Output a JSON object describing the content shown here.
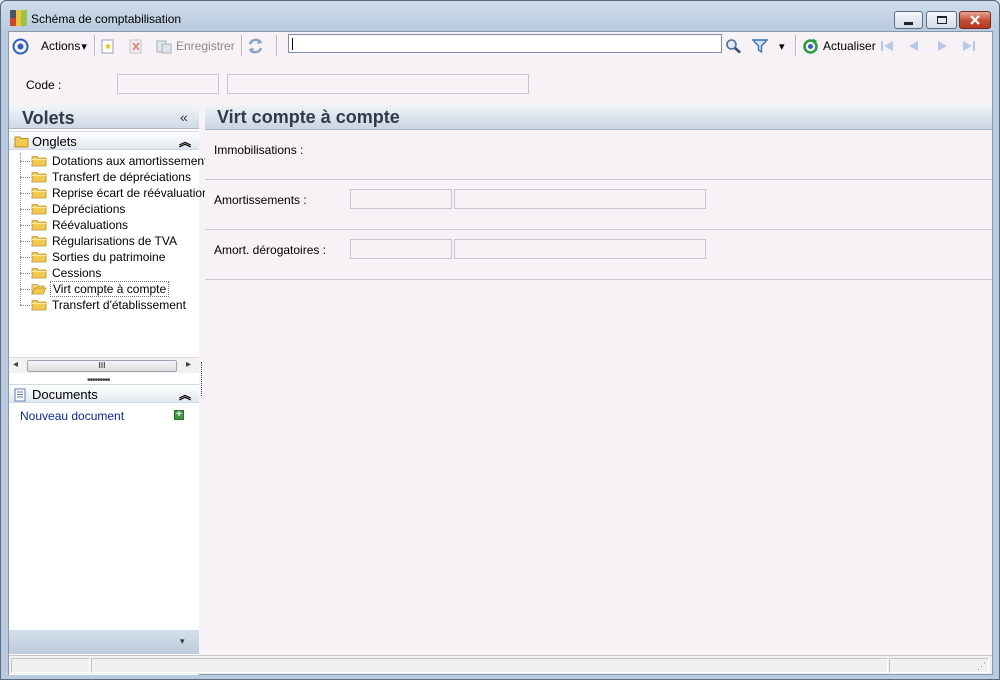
{
  "window": {
    "title": "Schéma de comptabilisation"
  },
  "toolbar": {
    "actions_label": "Actions",
    "actions_caret": "▾",
    "save_label": "Enregistrer",
    "search_value": "",
    "filter_caret": "▾",
    "refresh_label": "Actualiser"
  },
  "code": {
    "label": "Code :",
    "value": "",
    "description": ""
  },
  "volets": {
    "title": "Volets",
    "collapse": "«",
    "onglets_title": "Onglets",
    "onglets_chevron": "︽",
    "items": [
      {
        "label": "Dotations aux amortissements"
      },
      {
        "label": "Transfert de dépréciations"
      },
      {
        "label": "Reprise écart de réévaluation"
      },
      {
        "label": "Dépréciations"
      },
      {
        "label": "Réévaluations"
      },
      {
        "label": "Régularisations de TVA"
      },
      {
        "label": "Sorties du patrimoine"
      },
      {
        "label": "Cessions"
      },
      {
        "label": "Virt compte à compte"
      },
      {
        "label": "Transfert d'établissement"
      }
    ],
    "selected_index": 8,
    "scroll_thumb": "III",
    "grip": "•••••••••",
    "documents_title": "Documents",
    "documents_chevron": "︽",
    "new_document": "Nouveau document",
    "new_document_plus": "+",
    "bottom_dropdown": "▾"
  },
  "detail": {
    "title": "Virt compte à compte",
    "immobilisations_label": "Immobilisations :",
    "amortissements_label": "Amortissements :",
    "amortissements_code": "",
    "amortissements_desc": "",
    "derogatoires_label": "Amort. dérogatoires :",
    "derogatoires_code": "",
    "derogatoires_desc": ""
  },
  "statusbar": {
    "cell1": "",
    "cell2": "",
    "cell3": "",
    "grip": "⋰"
  }
}
